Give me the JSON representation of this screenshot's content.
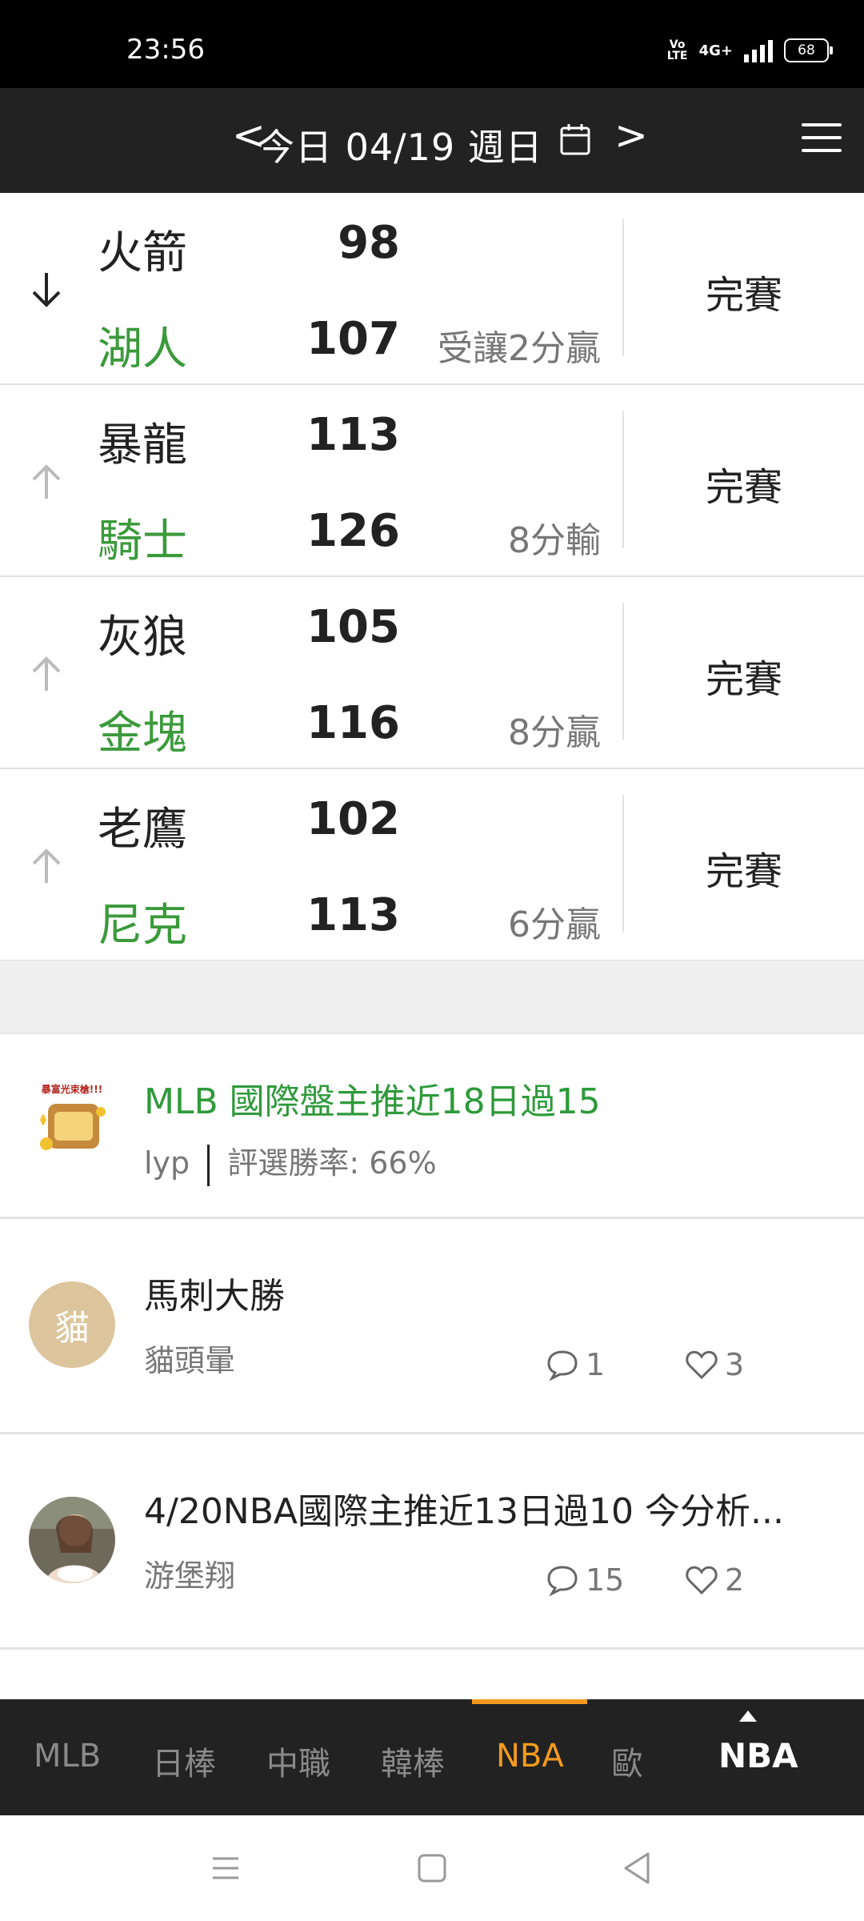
{
  "status_bar": {
    "time": "23:56",
    "volte": "Vo LTE",
    "network": "4G+",
    "battery": "68"
  },
  "header": {
    "prev_label": "<",
    "date_label": "今日 04/19 週日",
    "next_label": ">",
    "calendar_icon": "calendar-icon",
    "menu_icon": "hamburger-menu-icon"
  },
  "games": [
    {
      "away_team": "火箭",
      "away_score": "98",
      "home_team": "湖人",
      "home_score": "107",
      "result": "受讓2分贏",
      "status": "完賽",
      "arrow": "down",
      "arrow_color": "#222222"
    },
    {
      "away_team": "暴龍",
      "away_score": "113",
      "home_team": "騎士",
      "home_score": "126",
      "result": "8分輸",
      "status": "完賽",
      "arrow": "up",
      "arrow_color": "#bbbbbb"
    },
    {
      "away_team": "灰狼",
      "away_score": "105",
      "home_team": "金塊",
      "home_score": "116",
      "result": "8分贏",
      "status": "完賽",
      "arrow": "up",
      "arrow_color": "#bbbbbb"
    },
    {
      "away_team": "老鷹",
      "away_score": "102",
      "home_team": "尼克",
      "home_score": "113",
      "result": "6分贏",
      "status": "完賽",
      "arrow": "up",
      "arrow_color": "#bbbbbb"
    }
  ],
  "posts": [
    {
      "title": "MLB 國際盤主推近18日過15",
      "author": "lyp",
      "win_rate": "評選勝率: 66%",
      "avatar_text": "暴富光束槍!!!",
      "title_color": "#2e9a3a"
    },
    {
      "title": "馬刺大勝",
      "author": "貓頭暈",
      "avatar_text": "貓",
      "comments": "1",
      "likes": "3"
    },
    {
      "title": "4/20NBA國際主推近13日過10 今分析...",
      "author": "游堡翔",
      "comments": "15",
      "likes": "2"
    }
  ],
  "tabs": [
    {
      "label": "MLB",
      "active": false
    },
    {
      "label": "日棒",
      "active": false
    },
    {
      "label": "中職",
      "active": false
    },
    {
      "label": "韓棒",
      "active": false
    },
    {
      "label": "NBA",
      "active": true
    },
    {
      "label": "歐",
      "active": false
    }
  ],
  "tab_selector": {
    "label": "NBA"
  },
  "colors": {
    "accent": "#f39a1e",
    "home_team": "#3a9a3a",
    "header_bg": "#222222"
  }
}
